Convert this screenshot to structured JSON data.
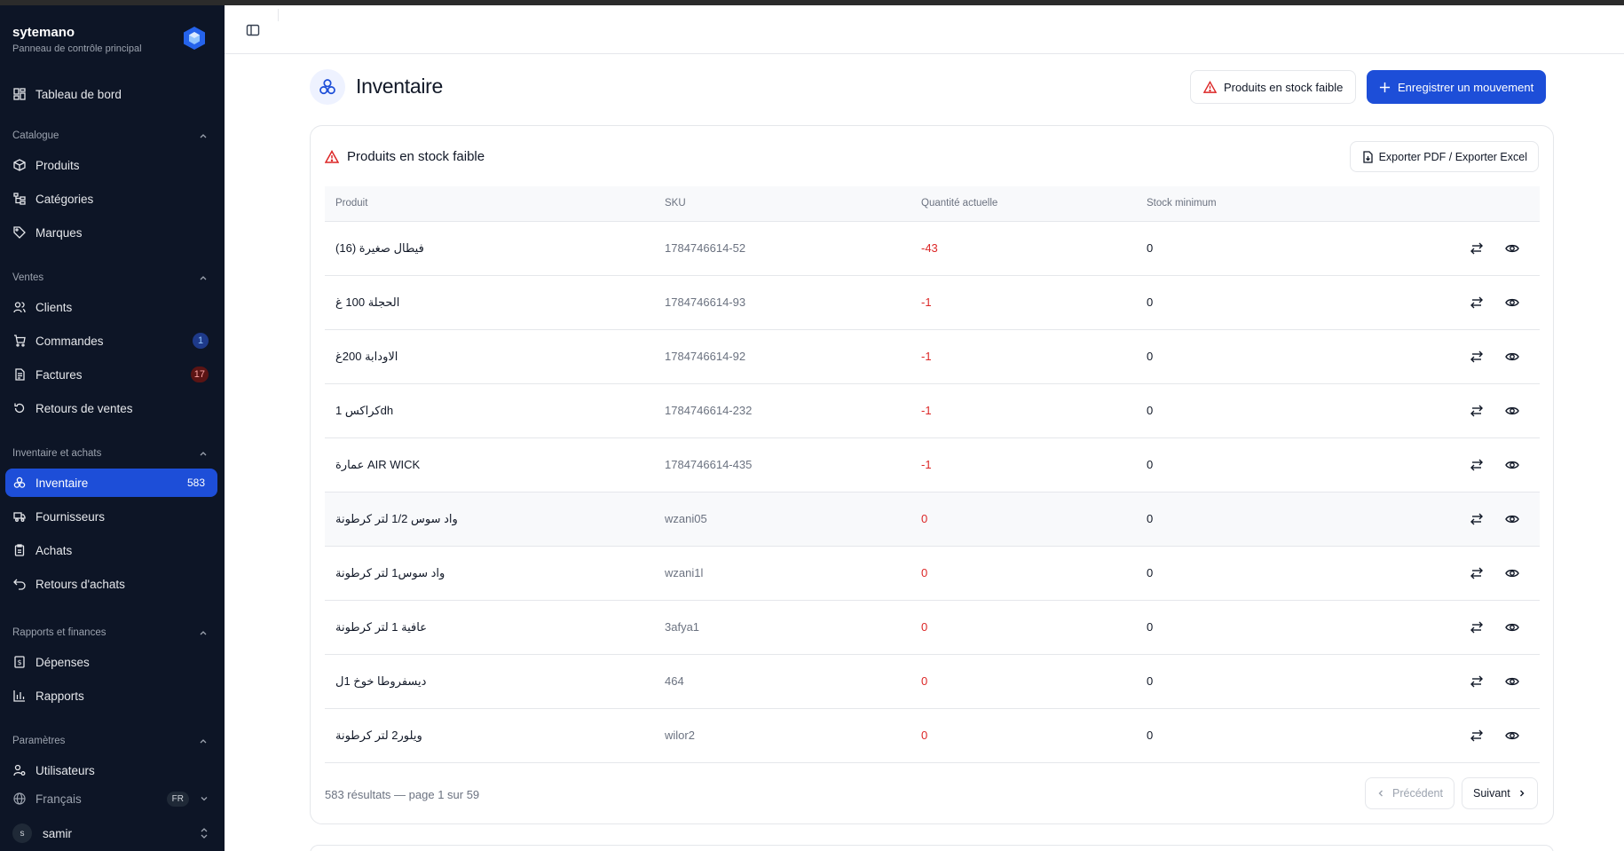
{
  "brand": {
    "name": "sytemano",
    "subtitle": "Panneau de contrôle principal"
  },
  "sidebar": {
    "dashboard": "Tableau de bord",
    "sections": {
      "catalogue": "Catalogue",
      "ventes": "Ventes",
      "inventaire": "Inventaire et achats",
      "rapports": "Rapports et finances",
      "parametres": "Paramètres"
    },
    "items": {
      "produits": "Produits",
      "categories": "Catégories",
      "marques": "Marques",
      "clients": "Clients",
      "commandes": "Commandes",
      "commandes_badge": "1",
      "factures": "Factures",
      "factures_badge": "17",
      "retours_ventes": "Retours de ventes",
      "inventaire": "Inventaire",
      "inventaire_badge": "583",
      "fournisseurs": "Fournisseurs",
      "achats": "Achats",
      "retours_achats": "Retours d'achats",
      "depenses": "Dépenses",
      "rapports": "Rapports",
      "utilisateurs": "Utilisateurs",
      "langue": "Français",
      "langue_code": "FR",
      "user_initial": "s",
      "user_name": "samir"
    }
  },
  "page": {
    "title": "Inventaire",
    "low_stock_button": "Produits en stock faible",
    "record_button": "Enregistrer un mouvement"
  },
  "card": {
    "title": "Produits en stock faible",
    "export_button": "Exporter PDF / Exporter Excel",
    "columns": {
      "product": "Produit",
      "sku": "SKU",
      "qty": "Quantité actuelle",
      "min": "Stock minimum"
    },
    "rows": [
      {
        "product": "فيطال صغيرة (16)",
        "sku": "1784746614-52",
        "qty": "-43",
        "min": "0"
      },
      {
        "product": "الحجلة 100 غ",
        "sku": "1784746614-93",
        "qty": "-1",
        "min": "0"
      },
      {
        "product": "الاودابة 200غ",
        "sku": "1784746614-92",
        "qty": "-1",
        "min": "0"
      },
      {
        "product": "كراكس 1dh",
        "sku": "1784746614-232",
        "qty": "-1",
        "min": "0"
      },
      {
        "product": "عمارة AIR WICK",
        "sku": "1784746614-435",
        "qty": "-1",
        "min": "0"
      },
      {
        "product": "واد سوس 1/2 لتر كرطونة",
        "sku": "wzani05",
        "qty": "0",
        "min": "0"
      },
      {
        "product": "واد سوس1 لتر كرطونة",
        "sku": "wzani1l",
        "qty": "0",
        "min": "0"
      },
      {
        "product": "عافية 1 لتر كرطونة",
        "sku": "3afya1",
        "qty": "0",
        "min": "0"
      },
      {
        "product": "ديسفروطا خوخ 1ل",
        "sku": "464",
        "qty": "0",
        "min": "0"
      },
      {
        "product": "ويلور2 لتر كرطونة",
        "sku": "wilor2",
        "qty": "0",
        "min": "0"
      }
    ],
    "footer": "583 résultats — page 1 sur 59",
    "prev": "Précédent",
    "next": "Suivant"
  },
  "colors": {
    "primary": "#1d4ed8",
    "sidebar": "#0d1526",
    "danger": "#dc2626"
  }
}
